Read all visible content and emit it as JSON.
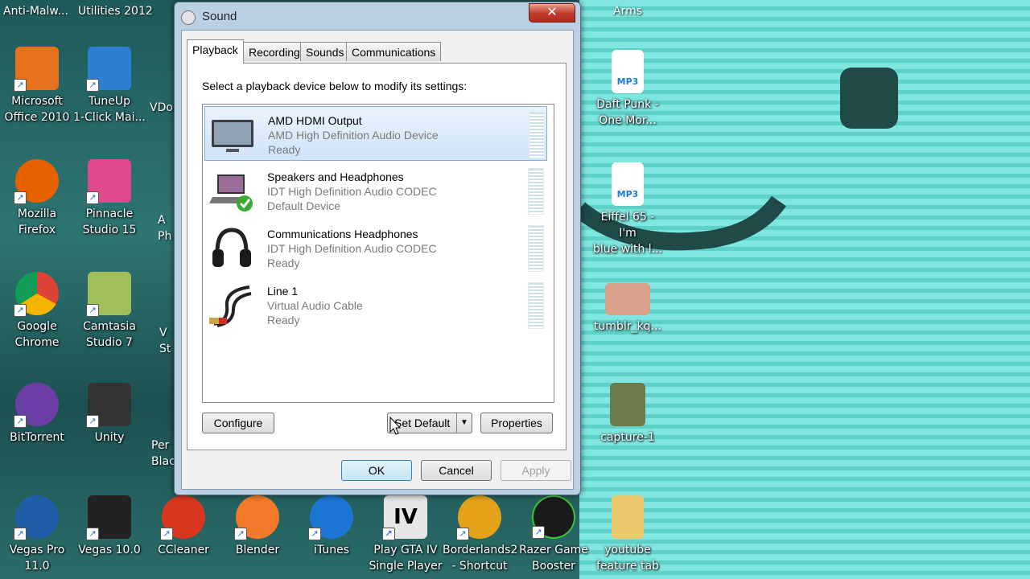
{
  "desktop": {
    "left_column": [
      {
        "name": "ms-office-shortcut",
        "icon": "office-icon",
        "label": "Microsoft\nOffice 2010",
        "color": "#e8721c"
      },
      {
        "name": "firefox-shortcut",
        "icon": "firefox-icon",
        "label": "Mozilla\nFirefox",
        "color": "#e66000"
      },
      {
        "name": "chrome-shortcut",
        "icon": "chrome-icon",
        "label": "Google\nChrome",
        "color": "#4285f4"
      },
      {
        "name": "bittorrent-shortcut",
        "icon": "bittorrent-icon",
        "label": "BitTorrent",
        "color": "#6b3ea6"
      },
      {
        "name": "vegas-pro-shortcut",
        "icon": "vegas-pro-icon",
        "label": "Vegas Pro\n11.0",
        "color": "#1e5fa8"
      }
    ],
    "second_column": [
      {
        "name": "tuneup-shortcut",
        "icon": "tuneup-icon",
        "label": "TuneUp\n1-Click Mai...",
        "color": "#2d7fd3"
      },
      {
        "name": "pinnacle-shortcut",
        "icon": "pinnacle-icon",
        "label": "Pinnacle\nStudio 15",
        "color": "#e04a8c"
      },
      {
        "name": "camtasia-shortcut",
        "icon": "camtasia-icon",
        "label": "Camtasia\nStudio 7",
        "color": "#9fbf5a"
      },
      {
        "name": "unity-shortcut",
        "icon": "unity-icon",
        "label": "Unity",
        "color": "#333333"
      },
      {
        "name": "vegas-10-shortcut",
        "icon": "vegas-10-icon",
        "label": "Vegas 10.0",
        "color": "#222222"
      }
    ],
    "top_labels": {
      "anti_malware": "Anti-Malw...",
      "utilities": "Utilities 2012",
      "arms": "Arms"
    },
    "cut_off_labels": {
      "vdo": "VDo",
      "a_ph": "A\nPh",
      "v_st": "V\nSt",
      "perf": "Per\nBlac"
    },
    "bottom_row": [
      {
        "name": "ccleaner-shortcut",
        "icon": "ccleaner-icon",
        "label": "CCleaner",
        "color": "#d8361f"
      },
      {
        "name": "blender-shortcut",
        "icon": "blender-icon",
        "label": "Blender",
        "color": "#f5792a"
      },
      {
        "name": "itunes-shortcut",
        "icon": "itunes-icon",
        "label": "iTunes",
        "color": "#1b76d3"
      },
      {
        "name": "gta4-shortcut",
        "icon": "gta-iv-icon",
        "label": "Play GTA IV\nSingle Player",
        "color": "#e6e6e6"
      },
      {
        "name": "borderlands2-shortcut",
        "icon": "borderlands-icon",
        "label": "Borderlands2\n- Shortcut",
        "color": "#e3a21a"
      },
      {
        "name": "razer-booster-shortcut",
        "icon": "razer-icon",
        "label": "Razer Game\nBooster",
        "color": "#3ac435"
      },
      {
        "name": "youtube-folder",
        "icon": "folder-icon",
        "label": "youtube\nfeature tab",
        "color": "#e9c86b"
      }
    ],
    "right_column": [
      {
        "name": "daft-punk-file",
        "icon": "mp3-file-icon",
        "label": "Daft Punk -\nOne Mor...",
        "badge": "MP3"
      },
      {
        "name": "eiffel65-file",
        "icon": "mp3-file-icon",
        "label": "Eiffel 65 - I'm\nblue with l...",
        "badge": "MP3"
      },
      {
        "name": "tumblr-image",
        "icon": "image-file-icon",
        "label": "tumblr_kq..."
      },
      {
        "name": "capture-video",
        "icon": "video-file-icon",
        "label": "capture-1"
      }
    ]
  },
  "dialog": {
    "title": "Sound",
    "close_label": "✕",
    "tabs": [
      "Playback",
      "Recording",
      "Sounds",
      "Communications"
    ],
    "instruction": "Select a playback device below to modify its settings:",
    "devices": [
      {
        "name": "AMD HDMI Output",
        "description": "AMD High Definition Audio Device",
        "status": "Ready",
        "icon": "monitor-icon",
        "selected": true
      },
      {
        "name": "Speakers and Headphones",
        "description": "IDT High Definition Audio CODEC",
        "status": "Default Device",
        "icon": "laptop-speaker-icon",
        "default": true
      },
      {
        "name": "Communications Headphones",
        "description": "IDT High Definition Audio CODEC",
        "status": "Ready",
        "icon": "headphones-icon"
      },
      {
        "name": "Line 1",
        "description": "Virtual Audio Cable",
        "status": "Ready",
        "icon": "rca-cable-icon"
      }
    ],
    "buttons": {
      "configure": "Configure",
      "set_default": "Set Default",
      "properties": "Properties",
      "ok": "OK",
      "cancel": "Cancel",
      "apply": "Apply"
    }
  }
}
